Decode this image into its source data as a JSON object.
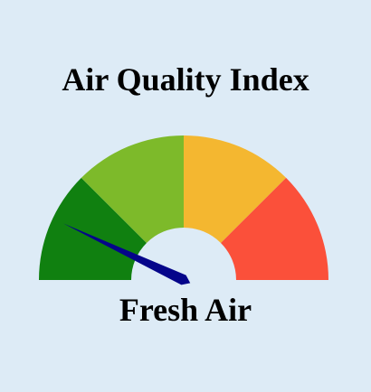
{
  "title": "Air Quality Index",
  "status": "Fresh Air",
  "gauge": {
    "min": 0,
    "max": 1,
    "value": 0.14,
    "bands": [
      {
        "name": "band-1",
        "from": 0,
        "to": 0.25,
        "color": "#108010"
      },
      {
        "name": "band-2",
        "from": 0.25,
        "to": 0.5,
        "color": "#7dba2a"
      },
      {
        "name": "band-3",
        "from": 0.5,
        "to": 0.75,
        "color": "#f4b730"
      },
      {
        "name": "band-4",
        "from": 0.75,
        "to": 1,
        "color": "#fb503a"
      }
    ],
    "needle_color": "#05058a"
  }
}
